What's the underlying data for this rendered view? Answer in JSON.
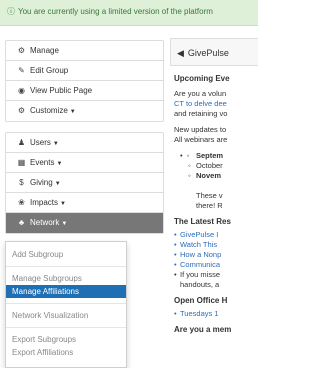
{
  "banner": {
    "icon": "info-circle-icon",
    "text": "You are currently using a limited version of the platform"
  },
  "sidebar": {
    "group1": [
      {
        "icon": "gears-icon",
        "glyph": "⚙",
        "label": "Manage"
      },
      {
        "icon": "pencil-icon",
        "glyph": "✎",
        "label": "Edit Group"
      },
      {
        "icon": "eye-icon",
        "glyph": "◉",
        "label": "View Public Page"
      },
      {
        "icon": "gears-icon",
        "glyph": "⚙",
        "label": "Customize",
        "caret": "▼"
      }
    ],
    "group2": [
      {
        "icon": "user-icon",
        "glyph": "♟",
        "label": "Users",
        "caret": "▼"
      },
      {
        "icon": "calendar-icon",
        "glyph": "▦",
        "label": "Events",
        "caret": "▼"
      },
      {
        "icon": "dollar-icon",
        "glyph": "$",
        "label": "Giving",
        "caret": "▼"
      },
      {
        "icon": "impacts-icon",
        "glyph": "❀",
        "label": "Impacts",
        "caret": "▼"
      },
      {
        "icon": "sitemap-icon",
        "glyph": "♣",
        "label": "Network",
        "caret": "▼",
        "active": true
      }
    ]
  },
  "network_menu": {
    "items": [
      "Add Subgroup",
      "Manage Subgroups",
      "Manage Affiliations",
      "Network Visualization",
      "Export Subgroups",
      "Export Affiliations"
    ],
    "selected": "Manage Affiliations"
  },
  "content": {
    "panel_title": "GivePulse",
    "upcoming": "Upcoming Eve",
    "p1_l1": "Are you a volun",
    "p1_l2": "CT to delve dee",
    "p1_l3": "and retaining vo",
    "p2_l1": "New updates to",
    "p2_l2": "All webinars are",
    "sub1": "Septem",
    "sub2": "October",
    "sub3": "Novem",
    "these_l1": "These v",
    "these_l2": "there! R",
    "latest": "The Latest Res",
    "li1": "GivePulse I",
    "li2": "Watch This",
    "li3": "How a Nonp",
    "li4": "Communica",
    "li5": "If you misse",
    "li5b": "handouts, a",
    "office": "Open Office H",
    "tues": "Tuesdays 1",
    "member": "Are you a mem"
  }
}
